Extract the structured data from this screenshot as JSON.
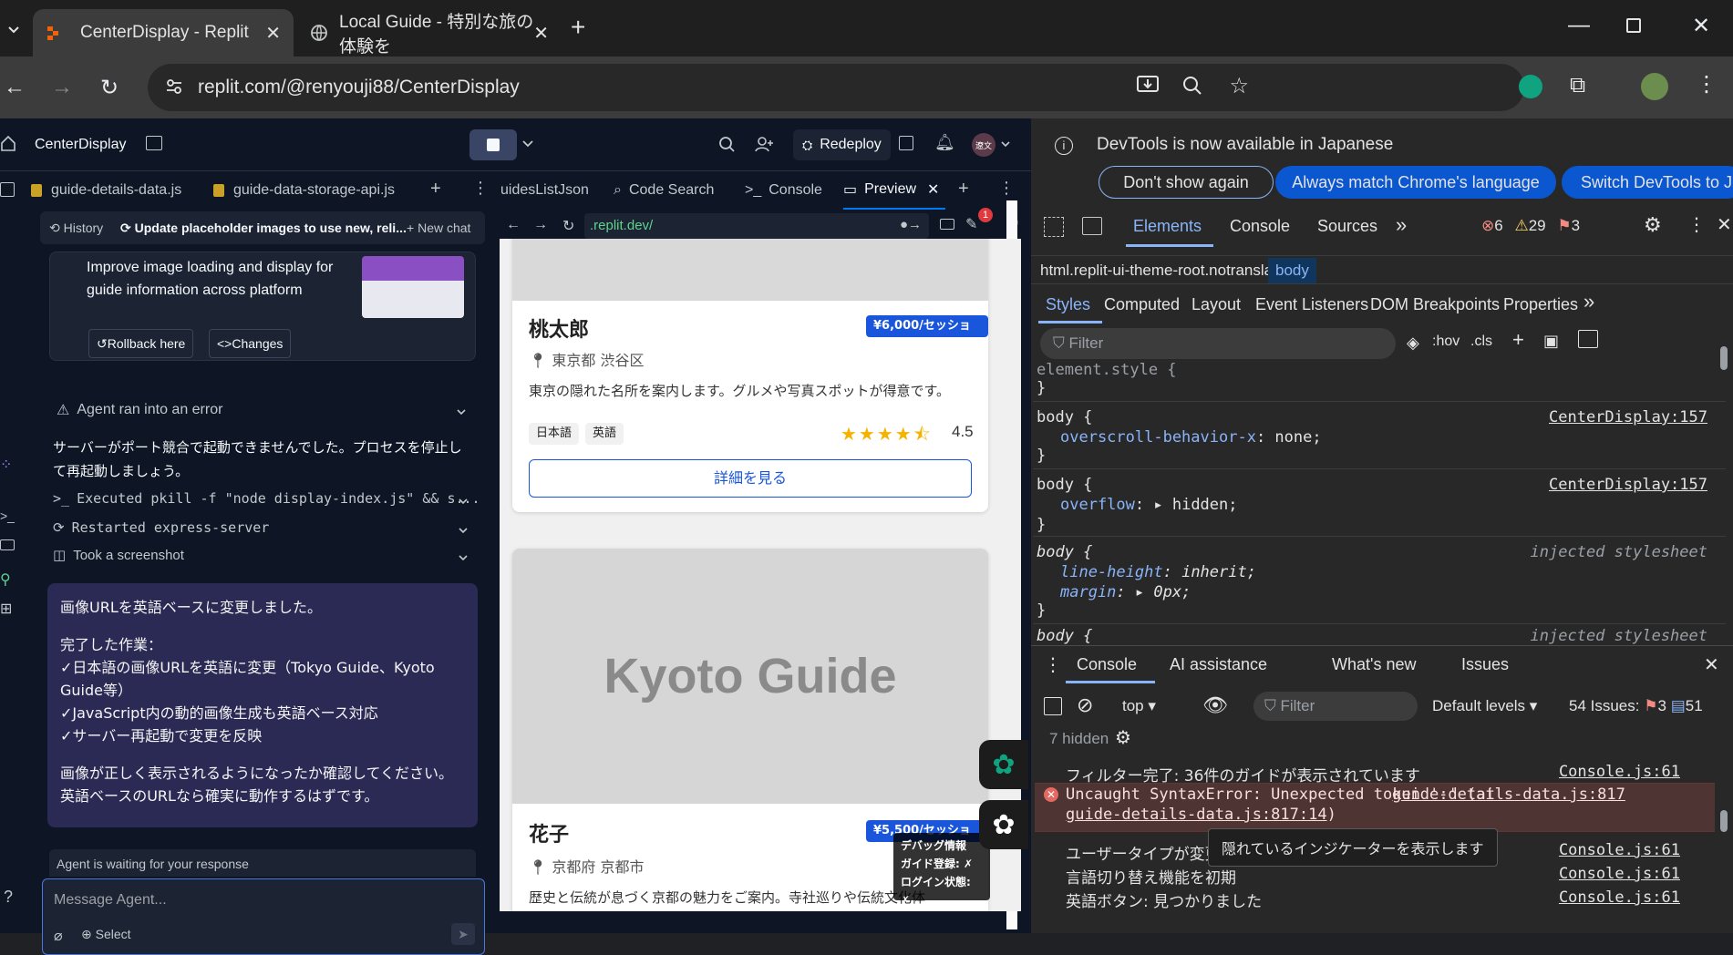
{
  "browser": {
    "tabs": [
      {
        "title": "CenterDisplay - Replit",
        "active": true
      },
      {
        "title": "Local Guide - 特別な旅の体験を",
        "active": false
      }
    ],
    "url": "replit.com/@renyouji88/CenterDisplay"
  },
  "replit": {
    "project_name": "CenterDisplay",
    "redeploy_label": "Redeploy",
    "avatar_text": "遼文",
    "file_tabs": [
      "guide-details-data.js",
      "guide-data-storage-api.js"
    ],
    "pane_tabs": [
      "uidesListJson",
      "Code Search",
      "Console",
      "Preview"
    ],
    "preview_url": ".replit.dev/",
    "notification_count": "1",
    "chat": {
      "history_label": "History",
      "thread_title": "Update placeholder images to use new, reli...",
      "new_chat_label": "New chat",
      "checkpoint_text": "Improve image loading and display for guide information across platform",
      "rollback_label": "Rollback here",
      "changes_label": "Changes",
      "error_label": "Agent ran into an error",
      "error_message": "サーバーがポート競合で起動できませんでした。プロセスを停止して再起動しましょう。",
      "actions": [
        "Executed pkill -f \"node display-index.js\" && s...",
        "Restarted express-server",
        "Took a screenshot"
      ],
      "agent_message": {
        "line1": "画像URLを英語ベースに変更しました。",
        "heading": "完了した作業：",
        "items": [
          "✓日本語の画像URLを英語に変更（Tokyo Guide、Kyoto Guide等）",
          "✓JavaScript内の動的画像生成も英語ベース対応",
          "✓サーバー再起動で変更を反映"
        ],
        "closing": "画像が正しく表示されるようになったか確認してください。英語ベースのURLなら確実に動作するはずです。"
      },
      "waiting_text": "Agent is waiting for your response",
      "input_placeholder": "Message Agent...",
      "select_label": "Select"
    },
    "preview": {
      "cards": [
        {
          "name": "桃太郎",
          "price": "¥6,000/セッション",
          "location": "東京都 渋谷区",
          "description": "東京の隠れた名所を案内します。グルメや写真スポットが得意です。",
          "languages": [
            "日本語",
            "英語"
          ],
          "rating": "4.5",
          "button": "詳細を見る"
        },
        {
          "image_text": "Kyoto Guide",
          "name": "花子",
          "price": "¥5,500/セッション",
          "location": "京都府 京都市",
          "description": "歴史と伝統が息づく京都の魅力をご案内。寺社巡りや伝統文化体"
        }
      ],
      "debug": {
        "title": "デバッグ情報",
        "line1": "ガイド登録: ✗",
        "line2": "ログイン状態: ✗"
      }
    }
  },
  "devtools": {
    "banner_text": "DevTools is now available in Japanese",
    "banner_buttons": [
      "Don't show again",
      "Always match Chrome's language",
      "Switch DevTools to J"
    ],
    "main_tabs": [
      "Elements",
      "Console",
      "Sources"
    ],
    "counts": {
      "errors": "6",
      "warnings": "29",
      "issues": "3"
    },
    "breadcrumb": [
      "html.replit-ui-theme-root.notranslate",
      "body"
    ],
    "styles_tabs": [
      "Styles",
      "Computed",
      "Layout",
      "Event Listeners",
      "DOM Breakpoints",
      "Properties"
    ],
    "filter_placeholder": "Filter",
    "hov": ":hov",
    "cls": ".cls",
    "rules": [
      {
        "selector": "element.style {",
        "source": "",
        "props": []
      },
      {
        "selector": "body {",
        "source": "CenterDisplay:157",
        "props": [
          {
            "name": "overscroll-behavior-x",
            "value": "none;"
          }
        ]
      },
      {
        "selector": "body {",
        "source": "CenterDisplay:157",
        "props": [
          {
            "name": "overflow",
            "value": "hidden;"
          }
        ]
      },
      {
        "selector": "body {",
        "source": "injected stylesheet",
        "props": [
          {
            "name": "line-height",
            "value": "inherit;"
          },
          {
            "name": "margin",
            "value": "0px;"
          }
        ]
      },
      {
        "selector": "body {",
        "source": "injected stylesheet",
        "props": []
      }
    ],
    "drawer_tabs": [
      "Console",
      "AI assistance",
      "What's new",
      "Issues"
    ],
    "console_toolbar": {
      "context": "top",
      "filter": "Filter",
      "levels": "Default levels",
      "issues_label": "54 Issues:",
      "issues_err": "3",
      "issues_info": "51",
      "hidden": "7 hidden"
    },
    "console_lines": [
      {
        "text": "フィルター完了: 36件のガイドが表示されています",
        "source": "Console.js:61",
        "type": "log"
      },
      {
        "text": "Uncaught SyntaxError: Unexpected token ':' (at",
        "link1": "guide-details-data.js:817",
        "link2": "guide-details-data.js:817:14",
        "type": "error"
      },
      {
        "text": "ユーザータイプが変更されました: tourist",
        "source": "Console.js:61",
        "type": "log"
      },
      {
        "text": "言語切り替え機能を初期",
        "source": "Console.js:61",
        "type": "log"
      },
      {
        "text": "英語ボタン: 見つかりました",
        "source": "Console.js:61",
        "type": "log"
      }
    ],
    "tooltip": "隠れているインジケーターを表示します"
  }
}
